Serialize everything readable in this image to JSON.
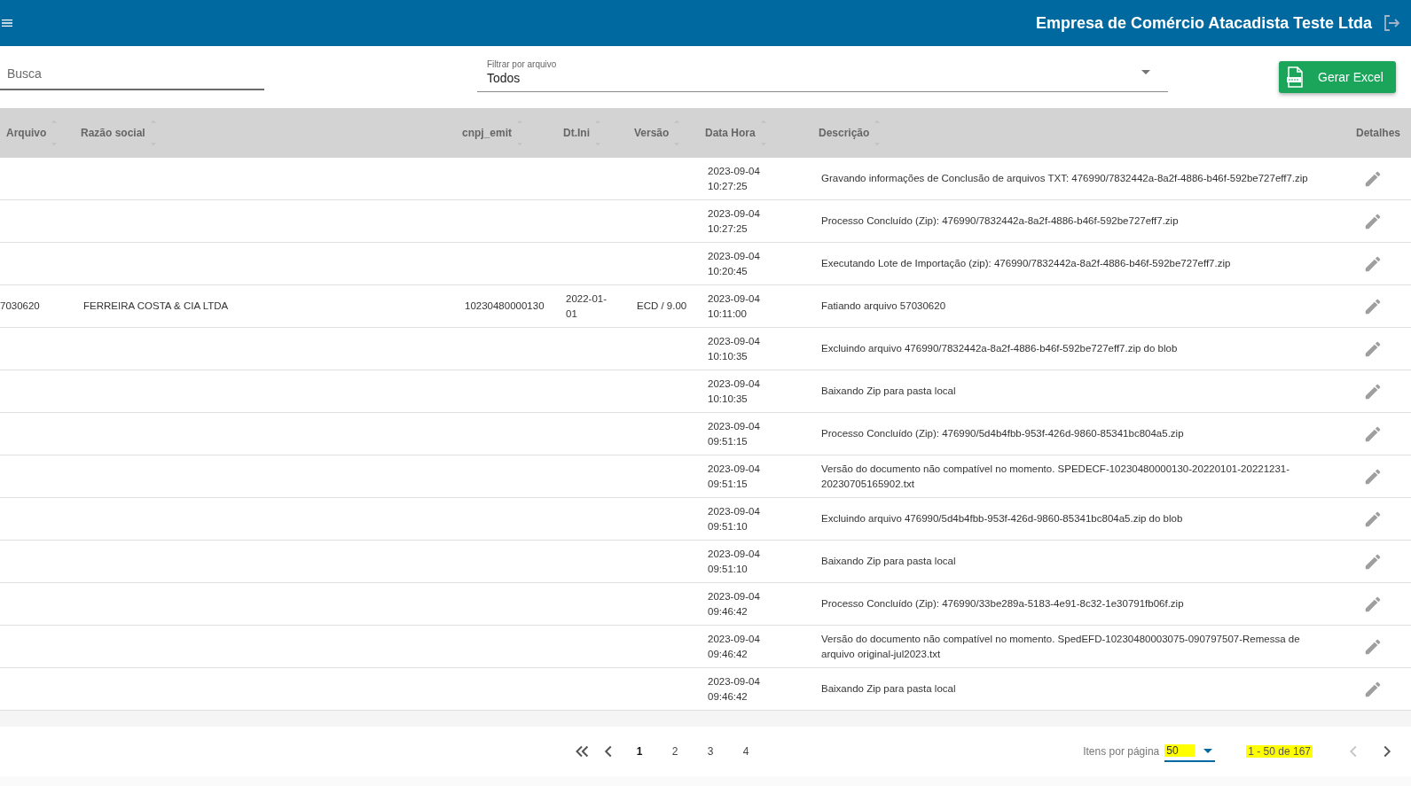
{
  "header": {
    "company": "Empresa de Comércio Atacadista Teste Ltda"
  },
  "filters": {
    "search": {
      "placeholder": "Busca"
    },
    "file_filter": {
      "label": "Filtrar por arquivo",
      "value": "Todos"
    },
    "excel_button": "Gerar Excel"
  },
  "table": {
    "columns": [
      {
        "label": "Arquivo",
        "sortable": true
      },
      {
        "label": "Razão social",
        "sortable": true
      },
      {
        "label": "cnpj_emit",
        "sortable": true
      },
      {
        "label": "Dt.Ini",
        "sortable": true
      },
      {
        "label": "Versão",
        "sortable": true
      },
      {
        "label": "Data Hora",
        "sortable": true
      },
      {
        "label": "Descrição",
        "sortable": true
      },
      {
        "label": "Detalhes",
        "sortable": false
      }
    ],
    "rows": [
      {
        "cells": [
          "",
          "",
          "",
          "",
          "",
          "2023-09-04 10:27:25",
          "Gravando informações de Conclusão de arquivos TXT: 476990/7832442a-8a2f-4886-b46f-592be727eff7.zip"
        ]
      },
      {
        "cells": [
          "",
          "",
          "",
          "",
          "",
          "2023-09-04 10:27:25",
          "Processo Concluído (Zip): 476990/7832442a-8a2f-4886-b46f-592be727eff7.zip"
        ]
      },
      {
        "cells": [
          "",
          "",
          "",
          "",
          "",
          "2023-09-04 10:20:45",
          "Executando Lote de Importação (zip): 476990/7832442a-8a2f-4886-b46f-592be727eff7.zip"
        ]
      },
      {
        "cells": [
          "7030620",
          "FERREIRA COSTA & CIA LTDA",
          "10230480000130",
          "2022-01-01",
          "ECD / 9.00",
          "2023-09-04 10:11:00",
          "Fatiando arquivo 57030620"
        ]
      },
      {
        "cells": [
          "",
          "",
          "",
          "",
          "",
          "2023-09-04 10:10:35",
          "Excluindo arquivo 476990/7832442a-8a2f-4886-b46f-592be727eff7.zip do blob"
        ]
      },
      {
        "cells": [
          "",
          "",
          "",
          "",
          "",
          "2023-09-04 10:10:35",
          "Baixando Zip para pasta local"
        ]
      },
      {
        "cells": [
          "",
          "",
          "",
          "",
          "",
          "2023-09-04 09:51:15",
          "Processo Concluído (Zip): 476990/5d4b4fbb-953f-426d-9860-85341bc804a5.zip"
        ]
      },
      {
        "cells": [
          "",
          "",
          "",
          "",
          "",
          "2023-09-04 09:51:15",
          "Versão do documento não compatível no momento. SPEDECF-10230480000130-20220101-20221231-20230705165902.txt"
        ]
      },
      {
        "cells": [
          "",
          "",
          "",
          "",
          "",
          "2023-09-04 09:51:10",
          "Excluindo arquivo 476990/5d4b4fbb-953f-426d-9860-85341bc804a5.zip do blob"
        ]
      },
      {
        "cells": [
          "",
          "",
          "",
          "",
          "",
          "2023-09-04 09:51:10",
          "Baixando Zip para pasta local"
        ]
      },
      {
        "cells": [
          "",
          "",
          "",
          "",
          "",
          "2023-09-04 09:46:42",
          "Processo Concluído (Zip): 476990/33be289a-5183-4e91-8c32-1e30791fb06f.zip"
        ]
      },
      {
        "cells": [
          "",
          "",
          "",
          "",
          "",
          "2023-09-04 09:46:42",
          "Versão do documento não compatível no momento. SpedEFD-10230480003075-090797507-Remessa de arquivo original-jul2023.txt"
        ]
      },
      {
        "cells": [
          "",
          "",
          "",
          "",
          "",
          "2023-09-04 09:46:42",
          "Baixando Zip para pasta local"
        ]
      }
    ]
  },
  "pagination": {
    "pages": [
      {
        "label": "1",
        "selected": true
      },
      {
        "label": "2",
        "selected": false
      },
      {
        "label": "3",
        "selected": false
      },
      {
        "label": "4",
        "selected": false
      }
    ],
    "items_label": "Itens por página",
    "page_size": "50",
    "range": "1 - 50 de 167",
    "prev_disabled": true,
    "next_disabled": false
  }
}
